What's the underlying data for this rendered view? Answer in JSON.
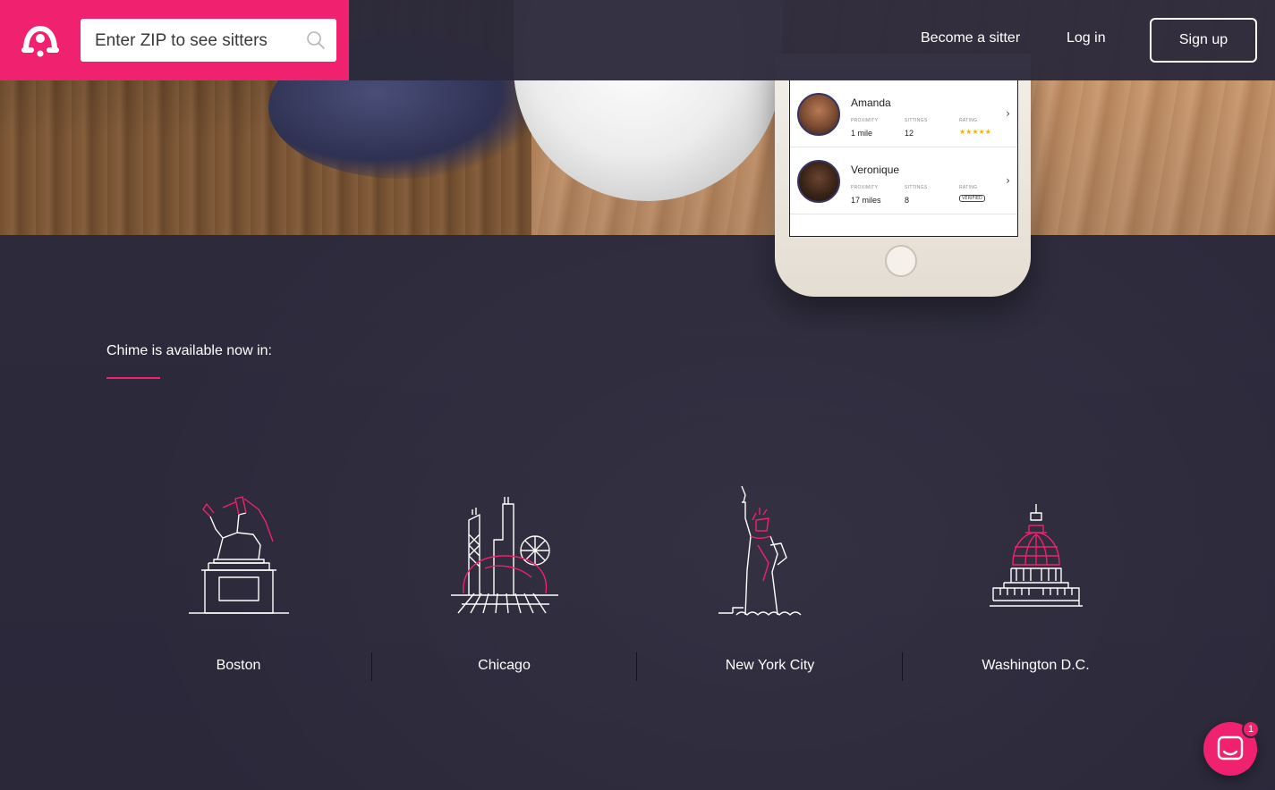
{
  "header": {
    "zip_placeholder": "Enter ZIP to see sitters",
    "nav": {
      "become_sitter": "Become a sitter",
      "log_in": "Log in",
      "sign_up": "Sign up"
    },
    "brand_color": "#f0216e"
  },
  "phone": {
    "sitters": [
      {
        "name": "Amanda",
        "proximity_label": "PROXIMITY",
        "proximity": "1 mile",
        "sittings_label": "SITTINGS",
        "sittings": "12",
        "rating_label": "RATING",
        "rating": "★★★★★"
      },
      {
        "name": "Veronique",
        "proximity_label": "PROXIMITY",
        "proximity": "17 miles",
        "sittings_label": "SITTINGS",
        "sittings": "8",
        "rating_label": "RATING",
        "rating": "VERIFIED"
      }
    ]
  },
  "availability": {
    "heading": "Chime is available now in:",
    "cities": [
      {
        "name": "Boston",
        "icon": "equestrian-statue-icon"
      },
      {
        "name": "Chicago",
        "icon": "cloud-gate-skyline-icon"
      },
      {
        "name": "New York City",
        "icon": "statue-of-liberty-icon"
      },
      {
        "name": "Washington D.C.",
        "icon": "capitol-building-icon"
      }
    ]
  },
  "chat": {
    "badge_count": "1",
    "icon": "chat-icon"
  }
}
